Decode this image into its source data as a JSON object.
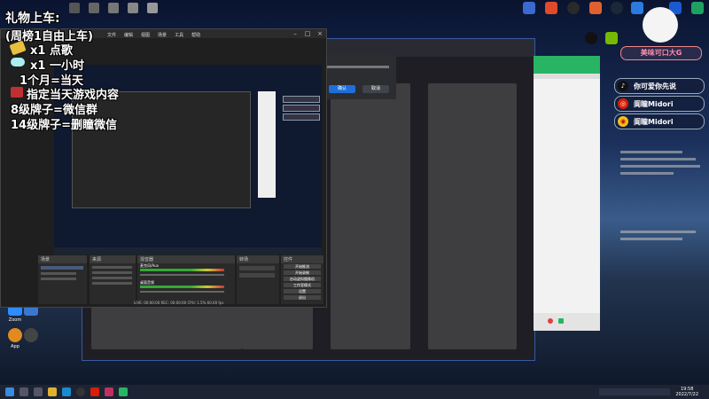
{
  "overlay": {
    "title": "礼物上车:",
    "lines": [
      "(周榜1自由上车)",
      "x1  点歌",
      "x1  一小时",
      "1个月=当天",
      "指定当天游戏内容",
      "8级牌子=微信群",
      "14级牌子=删瞳微信"
    ]
  },
  "social": [
    {
      "icon": "douyin-icon",
      "label": "你可爱你先说"
    },
    {
      "icon": "netease-icon",
      "label": "阆瞳Midori"
    },
    {
      "icon": "weibo-icon",
      "label": "阆瞳Midori"
    }
  ],
  "badge": {
    "label": "美味可口大G"
  },
  "obs": {
    "panels": [
      "场景",
      "来源",
      "混音器",
      "转场",
      "控件"
    ],
    "controls": [
      "开始推流",
      "开始录制",
      "启动虚拟摄像机",
      "工作室模式",
      "设置",
      "退出"
    ],
    "mixer_tracks": [
      "麦克风/Aux",
      "桌面音频"
    ],
    "status": "LIVE: 00:00:00  REC: 00:00:00  CPU: 1.5%  60.00 fps"
  },
  "dialog": {
    "confirm": "确认",
    "cancel": "取消"
  },
  "taskbar": {
    "time": "19:58",
    "date": "2022/7/22"
  },
  "colors": {
    "accent": "#1e6fd9",
    "green": "#28b463",
    "chat_bg": "#f2f2f2"
  }
}
